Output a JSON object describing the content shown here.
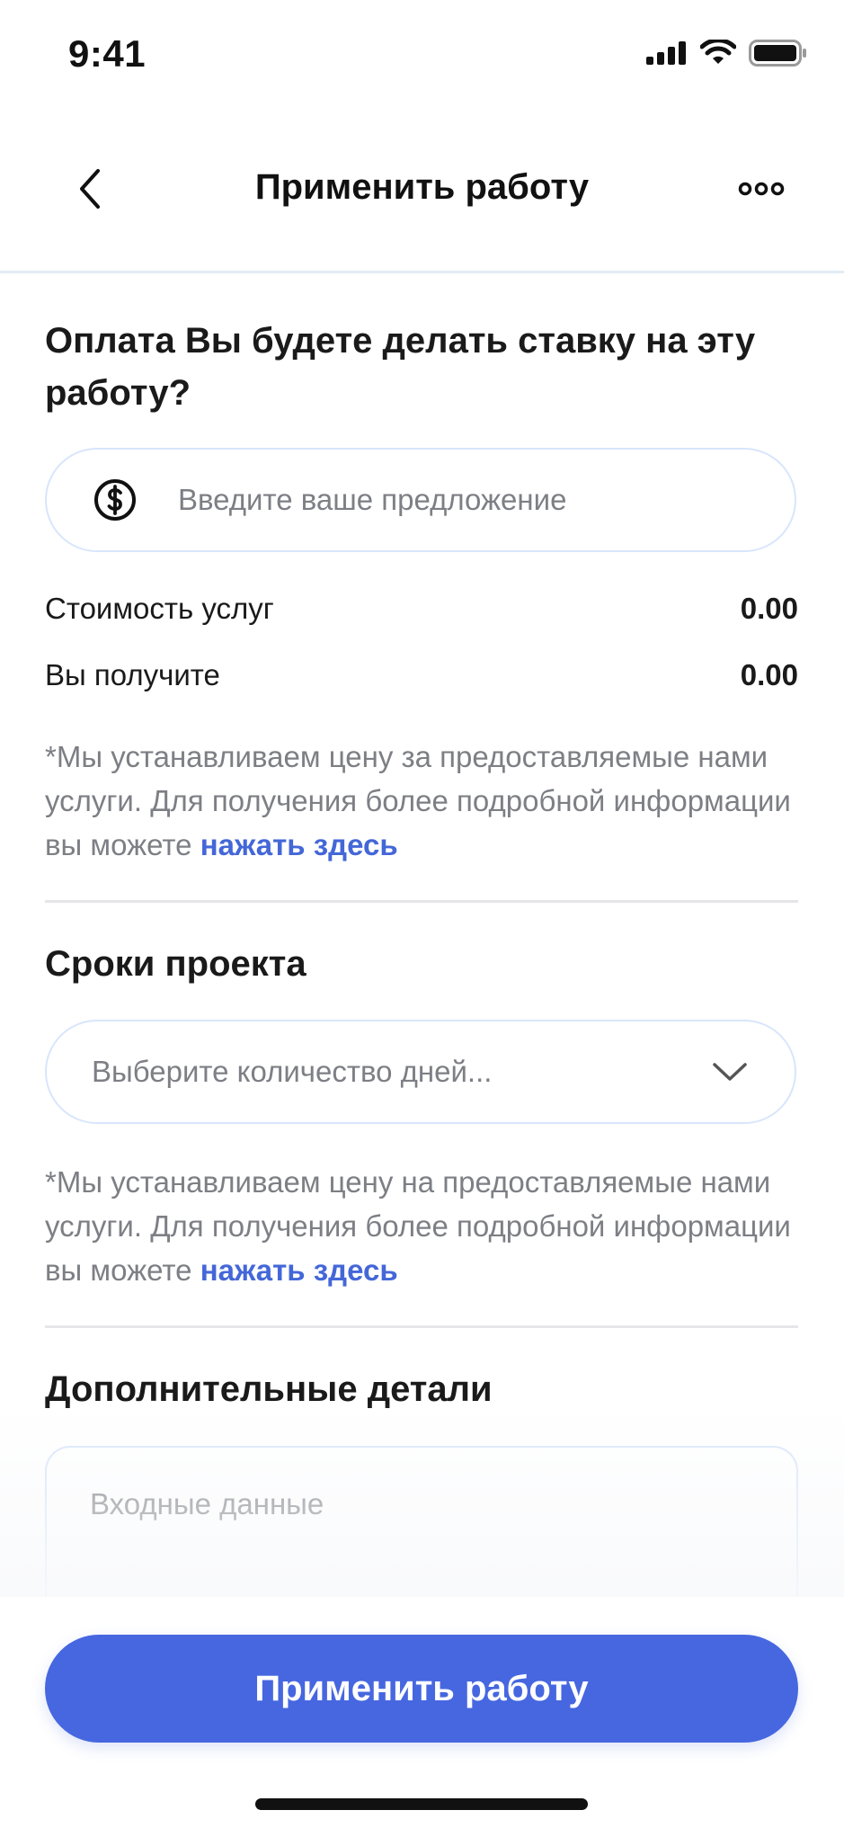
{
  "status_bar": {
    "time": "9:41"
  },
  "header": {
    "title": "Применить работу"
  },
  "payment": {
    "title": "Оплата Вы будете делать ставку на эту работу?",
    "input_placeholder": "Введите ваше предложение",
    "service_cost_label": "Стоимость услуг",
    "service_cost_value": "0.00",
    "you_receive_label": "Вы получите",
    "you_receive_value": "0.00",
    "note_text": "*Мы устанавливаем цену за предоставляемые нами услуги. Для получения более подробной информации вы можете ",
    "note_link": "нажать здесь"
  },
  "timeline": {
    "title": "Сроки проекта",
    "select_placeholder": "Выберите количество дней...",
    "note_text": "*Мы устанавливаем цену на предоставляемые нами услуги. Для получения более подробной информации вы можете ",
    "note_link": "нажать здесь"
  },
  "details": {
    "title": "Дополнительные детали",
    "input_placeholder": "Входные данные"
  },
  "footer": {
    "submit_label": "Применить работу"
  },
  "colors": {
    "accent": "#4667e0",
    "link": "#4467d8",
    "border": "#d8e6fb"
  },
  "icons": [
    "signal-icon",
    "wifi-icon",
    "battery-icon",
    "back-chevron-icon",
    "more-dots-icon",
    "dollar-circle-icon",
    "chevron-down-icon"
  ]
}
